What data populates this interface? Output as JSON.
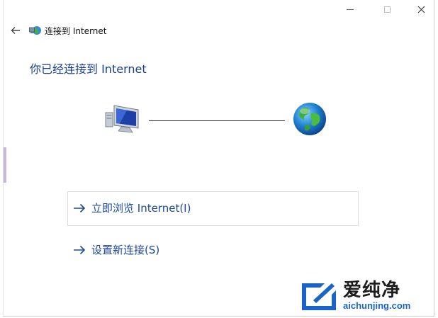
{
  "window": {
    "title": "连接到 Internet",
    "icons": {
      "app": "network-globe-icon",
      "back": "arrow-left-icon"
    }
  },
  "main": {
    "heading": "你已经连接到 Internet",
    "illustration": {
      "left_icon": "computer-monitor-icon",
      "right_icon": "globe-icon"
    }
  },
  "options": {
    "browse_label": "立即浏览 Internet(I)",
    "setup_label": "设置新连接(S)"
  },
  "watermark": {
    "text": "爱纯净",
    "url": "aichunjing.com"
  },
  "colors": {
    "accent": "#1a3f8f",
    "link": "#1f4aa0",
    "watermark_url": "#1a64c8"
  }
}
